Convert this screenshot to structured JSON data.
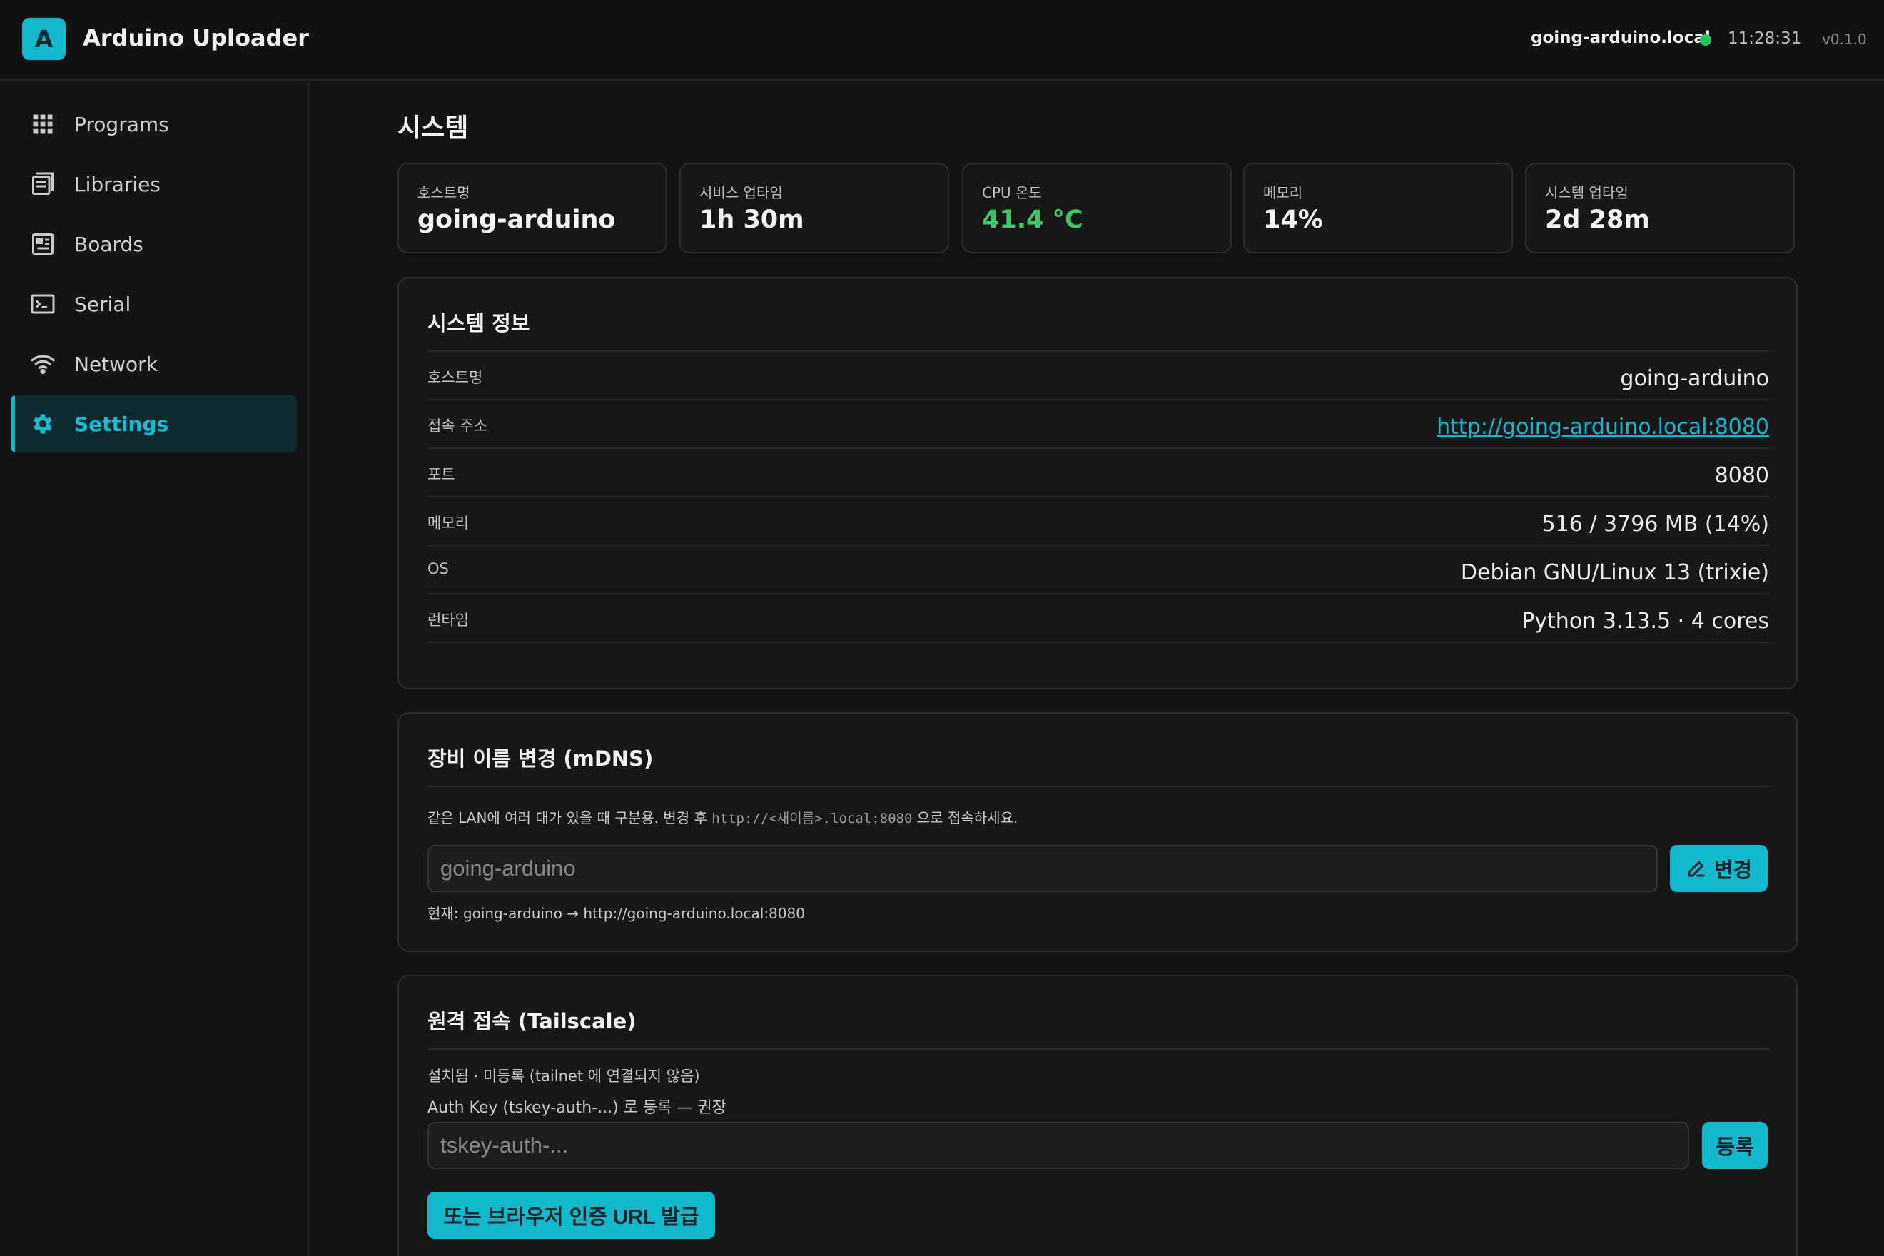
{
  "app": {
    "logo_letter": "A",
    "title": "Arduino Uploader",
    "host": "going-arduino.local",
    "time": "11:28:31",
    "version": "v0.1.0",
    "status_color": "#27c75a",
    "accent_color": "#12b8cc"
  },
  "sidebar": {
    "items": [
      {
        "label": "Programs",
        "icon": "grid-icon"
      },
      {
        "label": "Libraries",
        "icon": "book-icon"
      },
      {
        "label": "Boards",
        "icon": "board-icon"
      },
      {
        "label": "Serial",
        "icon": "terminal-icon"
      },
      {
        "label": "Network",
        "icon": "wifi-icon"
      },
      {
        "label": "Settings",
        "icon": "gear-icon",
        "active": true
      }
    ]
  },
  "page": {
    "title": "시스템"
  },
  "stats": [
    {
      "label": "호스트명",
      "value": "going-arduino"
    },
    {
      "label": "서비스 업타임",
      "value": "1h 30m"
    },
    {
      "label": "CPU 온도",
      "value": "41.4 °C"
    },
    {
      "label": "메모리",
      "value": "14%"
    },
    {
      "label": "시스템 업타임",
      "value": "2d 28m"
    }
  ],
  "system_info": {
    "title": "시스템 정보",
    "rows": [
      {
        "key": "호스트명",
        "value": "going-arduino"
      },
      {
        "key": "접속 주소",
        "value": "http://going-arduino.local:8080"
      },
      {
        "key": "포트",
        "value": "8080"
      },
      {
        "key": "메모리",
        "value": "516 / 3796 MB (14%)"
      },
      {
        "key": "OS",
        "value": "Debian GNU/Linux 13 (trixie)"
      },
      {
        "key": "런타임",
        "value": "Python 3.13.5 · 4 cores"
      }
    ]
  },
  "rename": {
    "title": "장비 이름 변경 (mDNS)",
    "hint_before": "같은 LAN에 여러 대가 있을 때 구분용. 변경 후 ",
    "hint_code": "http://<새이름>.local:8080",
    "hint_after": " 으로 접속하세요.",
    "input_placeholder": "going-arduino",
    "button_label": "변경",
    "current": "현재: going-arduino → http://going-arduino.local:8080"
  },
  "tailscale": {
    "title": "원격 접속 (Tailscale)",
    "status": "설치됨 · 미등록 (tailnet 에 연결되지 않음)",
    "auth_label": "Auth Key (tskey-auth-...) 로 등록 — 권장",
    "input_placeholder": "tskey-auth-...",
    "register_button": "등록",
    "browser_button": "또는 브라우저 인증 URL 발급"
  }
}
